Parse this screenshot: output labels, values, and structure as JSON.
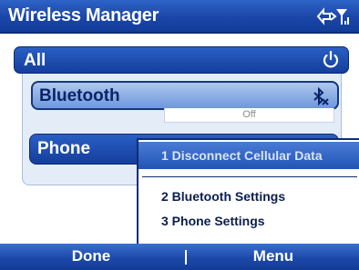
{
  "window": {
    "title": "Wireless Manager"
  },
  "status_icons": [
    "data-connection-icon",
    "signal-strength-icon"
  ],
  "all_toggle": {
    "label": "All",
    "icon": "power-icon"
  },
  "bluetooth": {
    "label": "Bluetooth",
    "status": "Off",
    "icon": "bluetooth-off-icon"
  },
  "phone": {
    "label": "Phone"
  },
  "menu": {
    "items": [
      {
        "label": "1 Disconnect Cellular Data",
        "selected": true
      },
      {
        "label": "2 Bluetooth Settings",
        "selected": false
      },
      {
        "label": "3 Phone Settings",
        "selected": false
      }
    ]
  },
  "softkeys": {
    "left": "Done",
    "right": "Menu"
  },
  "colors": {
    "title_blue": "#1b46a8",
    "highlight_blue": "#2254b4",
    "panel": "#e4ecf8"
  }
}
